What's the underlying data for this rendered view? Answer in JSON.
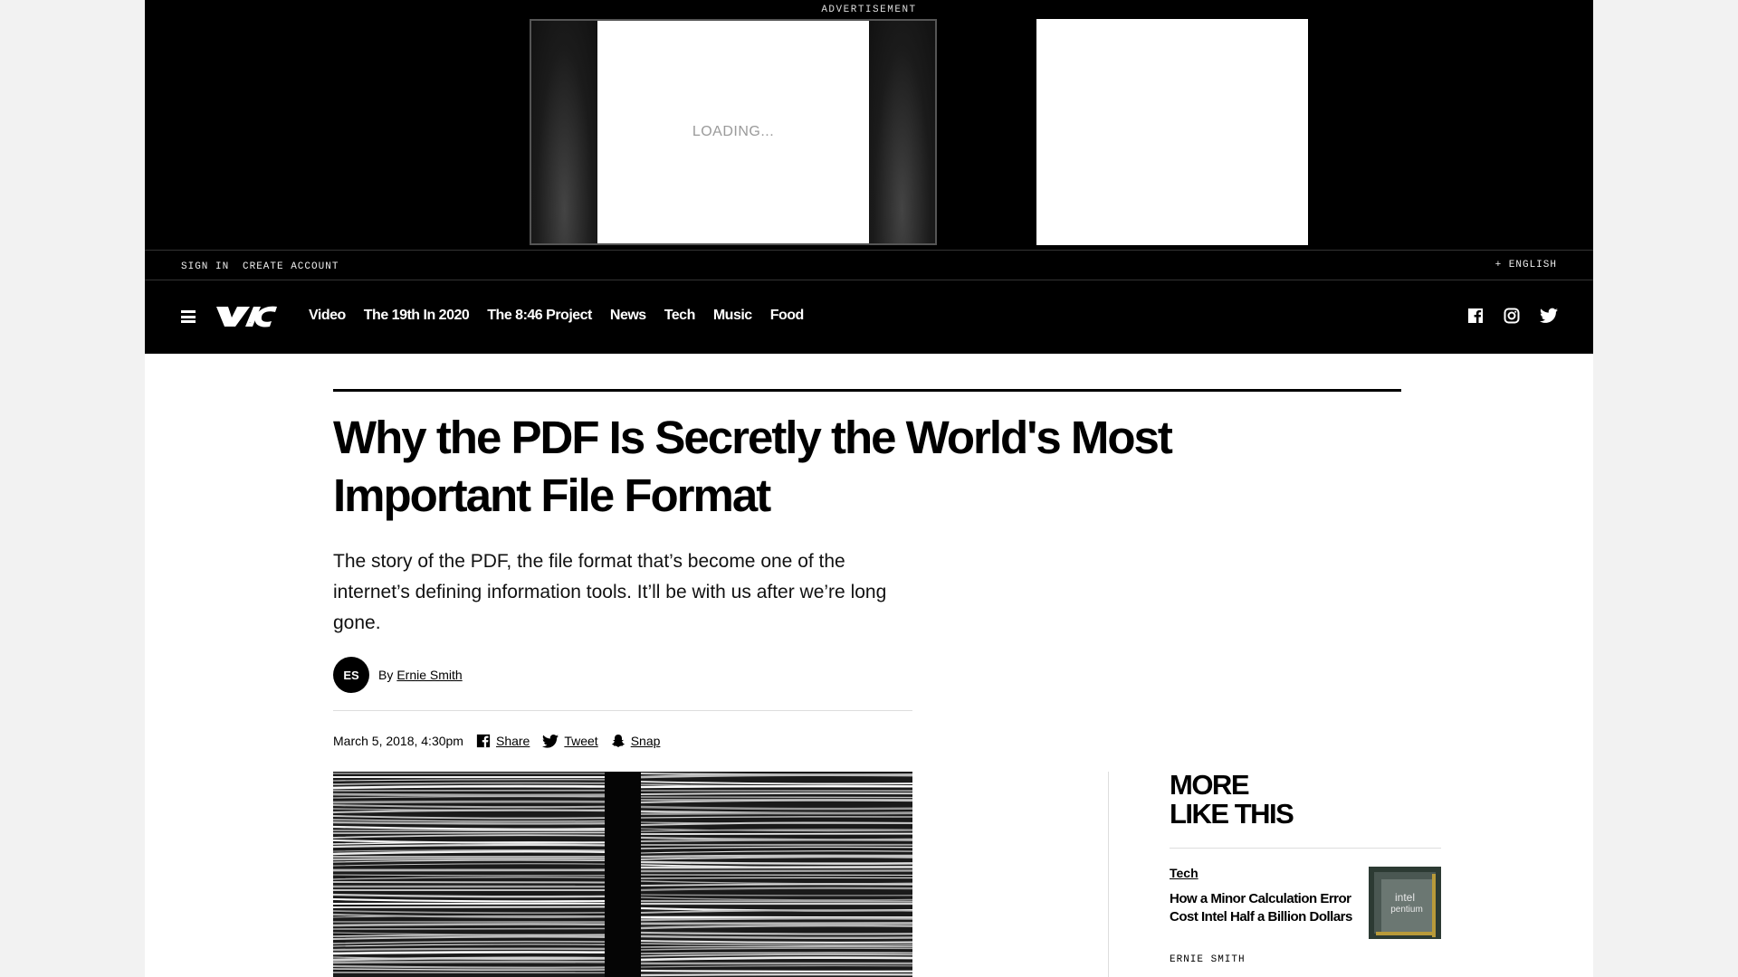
{
  "advertisement": {
    "label": "ADVERTISEMENT",
    "loading_text": "LOADING..."
  },
  "account_bar": {
    "sign_in": "SIGN IN",
    "create_account": "CREATE ACCOUNT",
    "language": "+ ENGLISH"
  },
  "nav": {
    "logo_text": "VICE",
    "items": [
      "Video",
      "The 19th In 2020",
      "The 8:46 Project",
      "News",
      "Tech",
      "Music",
      "Food"
    ],
    "social_icons": [
      "facebook-icon",
      "instagram-icon",
      "twitter-icon"
    ]
  },
  "article": {
    "headline": "Why the PDF Is Secretly the World's Most Important File Format",
    "dek": "The story of the PDF, the file format that’s become one of the internet’s defining information tools. It’ll be with us after we’re long gone.",
    "author_initials": "ES",
    "by_label": "By",
    "author": "Ernie Smith",
    "date": "March 5, 2018, 4:30pm",
    "share": {
      "facebook": "Share",
      "twitter": "Tweet",
      "snapchat": "Snap"
    }
  },
  "sidebar": {
    "title_line1": "MORE",
    "title_line2": "LIKE THIS",
    "cards": [
      {
        "tag": "Tech",
        "title": "How a Minor Calculation Error Cost Intel Half a Billion Dollars",
        "author": "ERNIE SMITH",
        "thumb_text_1": "intel",
        "thumb_text_2": "pentium"
      }
    ]
  },
  "colors": {
    "nav_background": "#000000",
    "page_background": "#ffffff",
    "outer_background": "#f2f2f2"
  }
}
